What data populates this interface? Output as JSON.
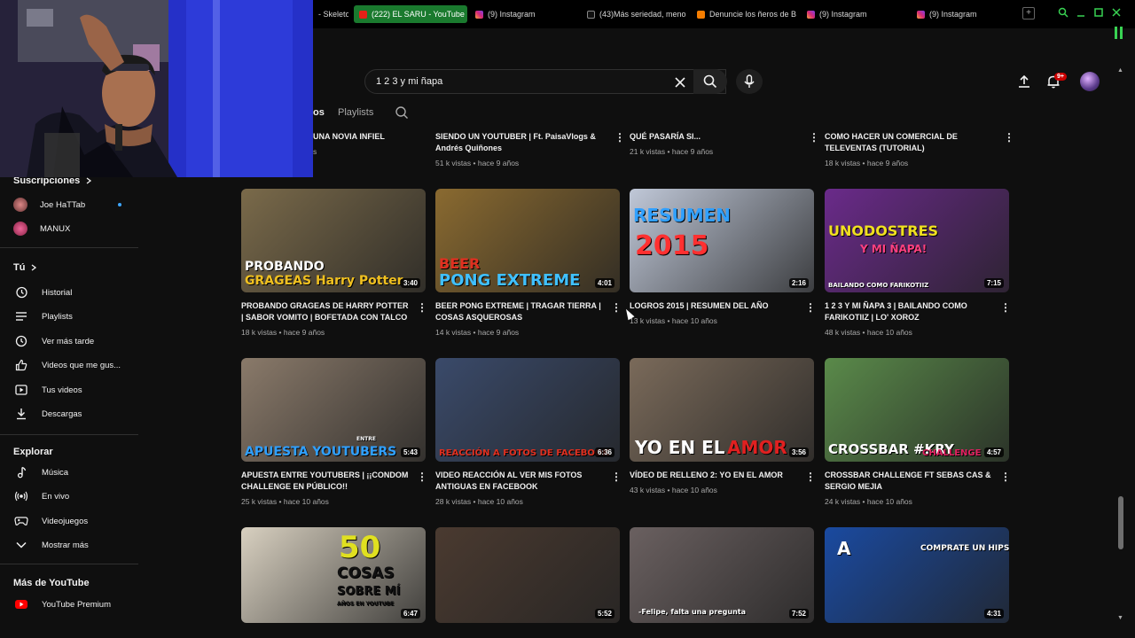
{
  "browser": {
    "tabs": [
      {
        "label": "- Skeleto",
        "icon": "none",
        "active": false
      },
      {
        "label": "(222) EL SARU - YouTube",
        "icon": "youtube",
        "active": true
      },
      {
        "label": "(9) Instagram",
        "icon": "instagram",
        "active": false
      },
      {
        "label": "(43)Más seriedad, meno",
        "icon": "tiktok",
        "active": false
      },
      {
        "label": "Denuncie los ñeros de B",
        "icon": "blogger",
        "active": false
      },
      {
        "label": "(9) Instagram",
        "icon": "instagram",
        "active": false
      },
      {
        "label": "(9) Instagram",
        "icon": "instagram",
        "active": false
      }
    ],
    "new_tab_label": "+",
    "accent": "#39d353"
  },
  "header": {
    "search_value": "1 2 3 y mi ñapa",
    "notif_count": "9+",
    "icons": [
      "upload-icon",
      "bell-icon",
      "search-icon",
      "mic-icon",
      "clear-icon"
    ]
  },
  "chips": {
    "partial": "os",
    "playlists": "Playlists"
  },
  "sidebar": {
    "subscriptions_title": "Suscripciones",
    "channels": [
      {
        "name": "Joe HaTTab",
        "live": true
      },
      {
        "name": "MANUX",
        "live": false
      }
    ],
    "you_title": "Tú",
    "you_items": [
      {
        "label": "Historial",
        "icon": "history-icon"
      },
      {
        "label": "Playlists",
        "icon": "playlist-icon"
      },
      {
        "label": "Ver más tarde",
        "icon": "clock-icon"
      },
      {
        "label": "Videos que me gus...",
        "icon": "thumb-up-icon"
      },
      {
        "label": "Tus videos",
        "icon": "video-icon"
      },
      {
        "label": "Descargas",
        "icon": "download-icon"
      }
    ],
    "explore_title": "Explorar",
    "explore_items": [
      {
        "label": "Música",
        "icon": "music-icon"
      },
      {
        "label": "En vivo",
        "icon": "live-icon"
      },
      {
        "label": "Videojuegos",
        "icon": "gamepad-icon"
      },
      {
        "label": "Mostrar más",
        "icon": "chevron-down-icon"
      }
    ],
    "more_title": "Más de YouTube",
    "more_items": [
      {
        "label": "YouTube Premium",
        "icon": "youtube-premium-icon"
      }
    ]
  },
  "top_row": [
    {
      "title": "UNA NOVIA INFIEL",
      "meta": "s"
    },
    {
      "title": "SIENDO UN YOUTUBER | Ft. PaisaVlogs & Andrés Quiñones",
      "meta": "51 k vistas • hace 9 años"
    },
    {
      "title": "QUÉ PASARÍA SI...",
      "meta": "21 k vistas • hace 9 años"
    },
    {
      "title": "COMO HACER UN COMERCIAL DE TELEVENTAS (TUTORIAL)",
      "meta": "18 k vistas • hace 9 años"
    }
  ],
  "videos": [
    {
      "title": "PROBANDO GRAGEAS DE HARRY POTTER | SABOR VOMITO | BOFETADA CON TALCO",
      "meta": "18 k vistas • hace 9 años",
      "duration": "3:40",
      "thumb_text": [
        "PROBANDO",
        "GRAGEAS Harry Potter"
      ],
      "thumb_bg": "#7a6a4a"
    },
    {
      "title": "BEER PONG EXTREME | TRAGAR TIERRA | COSAS ASQUEROSAS",
      "meta": "14 k vistas • hace 9 años",
      "duration": "4:01",
      "thumb_text": [
        "BEER",
        "PONG EXTREME"
      ],
      "thumb_bg": "#8a6a30"
    },
    {
      "title": "LOGROS 2015 | RESUMEN DEL AÑO",
      "meta": "13 k vistas • hace 10 años",
      "duration": "2:16",
      "thumb_text": [
        "RESUMEN",
        "2015"
      ],
      "thumb_bg": "#c0c8d8"
    },
    {
      "title": "1 2 3 Y MI ÑAPA 3 | BAILANDO COMO FARIKOTIIZ | LO' XOROZ",
      "meta": "48 k vistas • hace 10 años",
      "duration": "7:15",
      "thumb_text": [
        "UNODOSTRES",
        "Y MI ÑAPA!",
        "BAILANDO COMO FARIKOTIIZ"
      ],
      "thumb_bg": "#6a2a8a"
    },
    {
      "title": "APUESTA ENTRE YOUTUBERS | ¡¡CONDOM CHALLENGE EN PÚBLICO!!",
      "meta": "25 k vistas • hace 10 años",
      "duration": "5:43",
      "thumb_text": [
        "ENTRE",
        "APUESTA YOUTUBERS"
      ],
      "thumb_bg": "#8a7a6a"
    },
    {
      "title": "VIDEO REACCIÓN AL VER MIS FOTOS ANTIGUAS EN FACEBOOK",
      "meta": "28 k vistas • hace 10 años",
      "duration": "6:36",
      "thumb_text": [
        "REACCIÓN A FOTOS DE FACEBOOK"
      ],
      "thumb_bg": "#3a4a6a"
    },
    {
      "title": "VÍDEO DE RELLENO 2: YO EN EL AMOR",
      "meta": "43 k vistas • hace 10 años",
      "duration": "3:56",
      "thumb_text": [
        "YO EN EL",
        "AMOR"
      ],
      "thumb_bg": "#7a6a5a"
    },
    {
      "title": "CROSSBAR CHALLENGE FT SEBAS CAS & SERGIO MEJIA",
      "meta": "24 k vistas • hace 10 años",
      "duration": "4:57",
      "thumb_text": [
        "CROSSBAR #KRY",
        "CHALLENGE"
      ],
      "thumb_bg": "#5a8a4a"
    },
    {
      "title": "",
      "meta": "",
      "duration": "6:47",
      "thumb_text": [
        "50",
        "COSAS",
        "SOBRE MÍ",
        "AÑOS EN YOUTUBE"
      ],
      "thumb_bg": "#d8d0c0"
    },
    {
      "title": "",
      "meta": "",
      "duration": "5:52",
      "thumb_text": [],
      "thumb_bg": "#4a3a30"
    },
    {
      "title": "",
      "meta": "",
      "duration": "7:52",
      "thumb_text": [
        "-Felipe, falta una pregunta"
      ],
      "thumb_bg": "#6a6060"
    },
    {
      "title": "",
      "meta": "",
      "duration": "4:31",
      "thumb_text": [
        "A",
        "COMPRATE UN HIPSTER"
      ],
      "thumb_bg": "#1a4aa0"
    }
  ]
}
